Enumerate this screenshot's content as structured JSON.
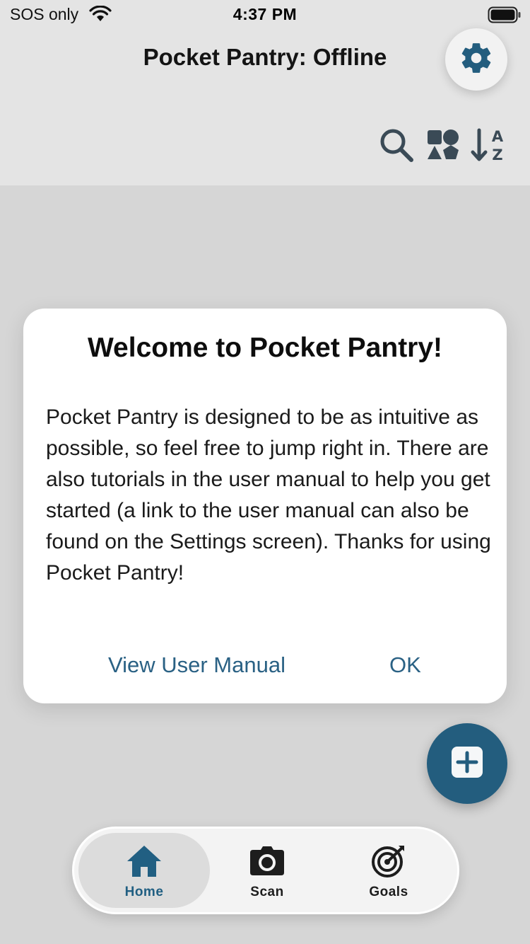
{
  "status_bar": {
    "carrier": "SOS only",
    "time": "4:37 PM",
    "wifi_icon": "wifi-icon",
    "battery_icon": "battery-icon"
  },
  "header": {
    "title": "Pocket Pantry: Offline",
    "settings_icon": "gear-icon",
    "toolbar": {
      "search_icon": "search-icon",
      "category_icon": "shapes-icon",
      "sort_icon": "sort-az-icon"
    }
  },
  "dialog": {
    "title": "Welcome to Pocket Pantry!",
    "body": "Pocket Pantry is designed to be as intuitive as possible, so feel free to jump right in. There are also tutorials in the user manual to help you get started (a link to the user manual can also be found on the Settings screen). Thanks for using Pocket Pantry!",
    "manual_label": "View User Manual",
    "ok_label": "OK"
  },
  "fab": {
    "icon": "plus-square-icon"
  },
  "bottom_nav": {
    "items": [
      {
        "label": "Home",
        "icon": "home-icon",
        "active": true
      },
      {
        "label": "Scan",
        "icon": "camera-icon",
        "active": false
      },
      {
        "label": "Goals",
        "icon": "target-icon",
        "active": false
      }
    ]
  },
  "colors": {
    "accent": "#235d7e",
    "link": "#2a6184",
    "background": "#d9d9d9",
    "dialog_bg": "#ffffff"
  }
}
